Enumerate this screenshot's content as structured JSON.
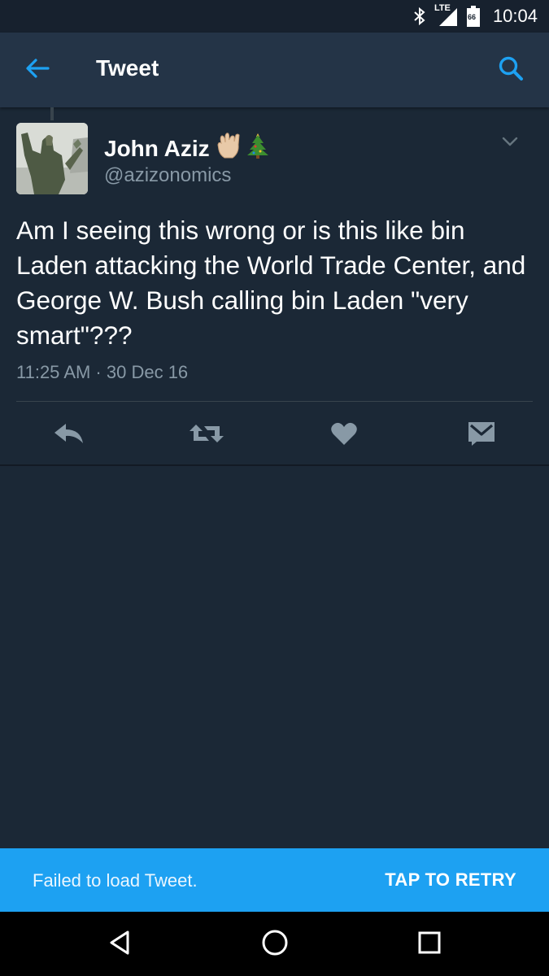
{
  "status_bar": {
    "time": "10:04",
    "network_label": "LTE",
    "battery_level": "66",
    "icons": [
      "bluetooth-icon",
      "lte-signal-icon",
      "battery-icon"
    ]
  },
  "app_bar": {
    "title": "Tweet",
    "back_icon": "arrow-left-icon",
    "search_icon": "search-icon",
    "accent_color": "#1da1f2"
  },
  "tweet": {
    "author_name": "John Aziz",
    "author_emojis": [
      "vulcan-salute-emoji",
      "christmas-tree-emoji"
    ],
    "handle": "@azizonomics",
    "text": "Am I seeing this wrong or is this like bin Laden attacking the World Trade Center, and George W. Bush calling bin Laden \"very smart\"???",
    "timestamp": "11:25 AM · 30 Dec 16",
    "actions": [
      "reply-icon",
      "retweet-icon",
      "like-icon",
      "direct-message-icon"
    ]
  },
  "snackbar": {
    "message": "Failed to load Tweet.",
    "action_label": "TAP TO RETRY"
  },
  "nav_bar": {
    "buttons": [
      "back-triangle-icon",
      "home-circle-icon",
      "recents-square-icon"
    ]
  },
  "colors": {
    "background": "#1b2836",
    "app_bar": "#243447",
    "secondary_text": "#8899a6",
    "icon_gray": "#8899a6",
    "snackbar": "#1da1f2"
  }
}
